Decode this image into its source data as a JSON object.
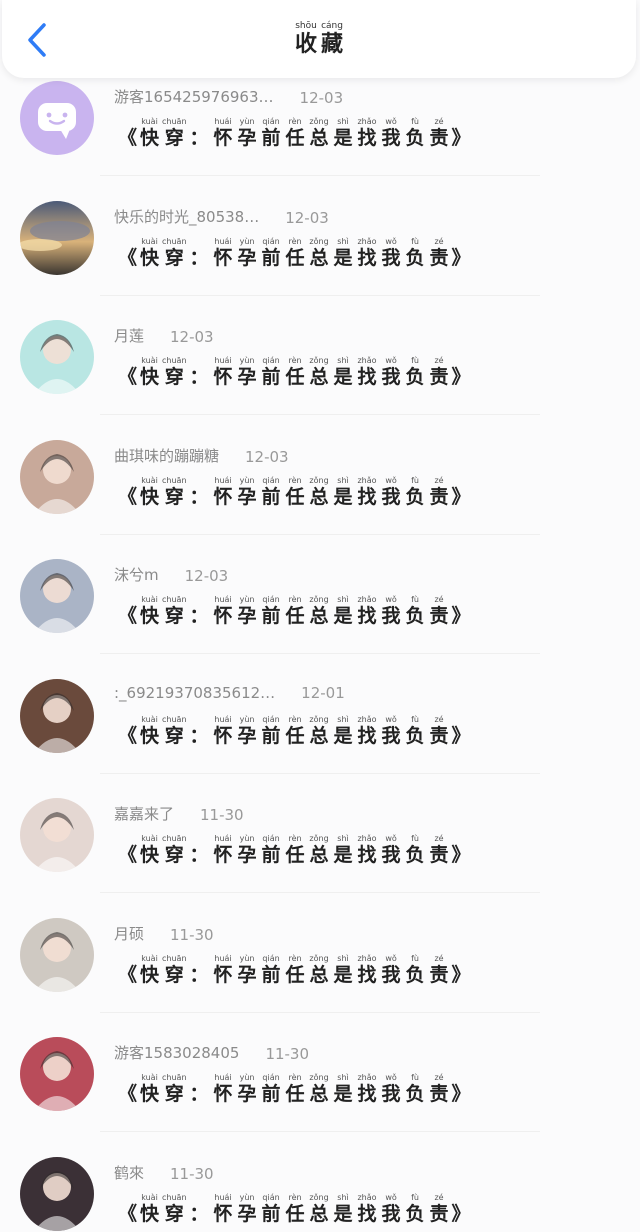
{
  "header": {
    "title": [
      {
        "py": "shōu",
        "hz": "收"
      },
      {
        "py": "cáng",
        "hz": "藏"
      }
    ]
  },
  "book": {
    "open": "《",
    "close": "》",
    "chars": [
      {
        "py": "kuài",
        "hz": "快"
      },
      {
        "py": "chuān",
        "hz": "穿"
      },
      {
        "py": "",
        "hz": "："
      },
      {
        "py": "huái",
        "hz": "怀"
      },
      {
        "py": "yùn",
        "hz": "孕"
      },
      {
        "py": "qián",
        "hz": "前"
      },
      {
        "py": "rèn",
        "hz": "任"
      },
      {
        "py": "zǒng",
        "hz": "总"
      },
      {
        "py": "shì",
        "hz": "是"
      },
      {
        "py": "zhǎo",
        "hz": "找"
      },
      {
        "py": "wǒ",
        "hz": "我"
      },
      {
        "py": "fù",
        "hz": "负"
      },
      {
        "py": "zé",
        "hz": "责"
      }
    ]
  },
  "items": [
    {
      "name": "游客165425976963…",
      "date": "12-03",
      "avatar": "chat-bubble-icon",
      "color": "#c9b4ef"
    },
    {
      "name": "快乐的时光_80538…",
      "date": "12-03",
      "avatar": "sunset-sky",
      "color": "#8a8f9c"
    },
    {
      "name": "月莲",
      "date": "12-03",
      "avatar": "anime-girl-cat-ears",
      "color": "#b9e6e3"
    },
    {
      "name": "曲琪味的蹦蹦糖",
      "date": "12-03",
      "avatar": "girl-with-apple",
      "color": "#c8a99a"
    },
    {
      "name": "沫兮m",
      "date": "12-03",
      "avatar": "anime-girl-dark-hair",
      "color": "#aab4c6"
    },
    {
      "name": ":_69219370835612…",
      "date": "12-01",
      "avatar": "girl-photo",
      "color": "#6a4a3c"
    },
    {
      "name": "嘉嘉来了",
      "date": "11-30",
      "avatar": "girl-white-hood",
      "color": "#e4d7d2"
    },
    {
      "name": "月硕",
      "date": "11-30",
      "avatar": "ancient-style-man",
      "color": "#cfc9c2"
    },
    {
      "name": "游客1583028405",
      "date": "11-30",
      "avatar": "anime-white-hair-red",
      "color": "#b94c5a"
    },
    {
      "name": "鹤來",
      "date": "11-30",
      "avatar": "dark-anime-boy",
      "color": "#3b3036"
    }
  ]
}
